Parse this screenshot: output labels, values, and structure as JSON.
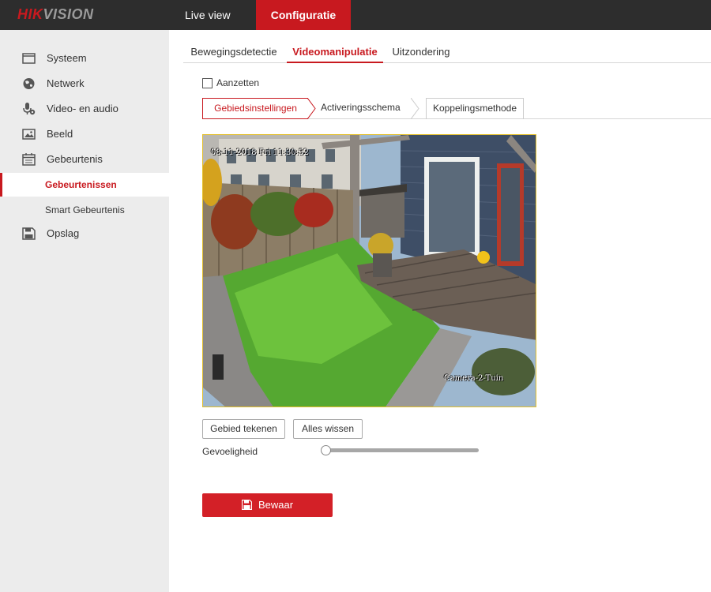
{
  "brand": {
    "logo_text_red": "HIK",
    "logo_text_grey": "VISION"
  },
  "topnav": {
    "live_view": "Live view",
    "configuration": "Configuratie"
  },
  "sidebar": {
    "items": [
      {
        "label": "Systeem",
        "icon": "monitor-icon"
      },
      {
        "label": "Netwerk",
        "icon": "globe-icon"
      },
      {
        "label": "Video- en audio",
        "icon": "microphone-icon"
      },
      {
        "label": "Beeld",
        "icon": "image-icon"
      },
      {
        "label": "Gebeurtenis",
        "icon": "calendar-icon"
      }
    ],
    "sub_items": [
      {
        "label": "Gebeurtenissen",
        "active": true
      },
      {
        "label": "Smart Gebeurtenis",
        "active": false
      }
    ],
    "storage": {
      "label": "Opslag",
      "icon": "floppy-icon"
    }
  },
  "tabs": [
    {
      "label": "Bewegingsdetectie",
      "active": false
    },
    {
      "label": "Videomanipulatie",
      "active": true
    },
    {
      "label": "Uitzondering",
      "active": false
    }
  ],
  "enable": {
    "label": "Aanzetten",
    "checked": false
  },
  "steps": [
    {
      "label": "Gebiedsinstellingen",
      "active": true
    },
    {
      "label": "Activeringsschema",
      "active": false
    },
    {
      "label": "Koppelingsmethode",
      "active": false
    }
  ],
  "camera": {
    "timestamp": "08-11-2018 Fri 11:30:52",
    "name": "Camera-2-Tuin"
  },
  "buttons": {
    "draw_area": "Gebied tekenen",
    "clear_all": "Alles wissen",
    "save": "Bewaar"
  },
  "sensitivity": {
    "label": "Gevoeligheid",
    "value": 0
  },
  "colors": {
    "accent": "#c8191f",
    "topbar": "#2d2d2d",
    "sidebar": "#ececec",
    "camera_border": "#e4c02a"
  }
}
